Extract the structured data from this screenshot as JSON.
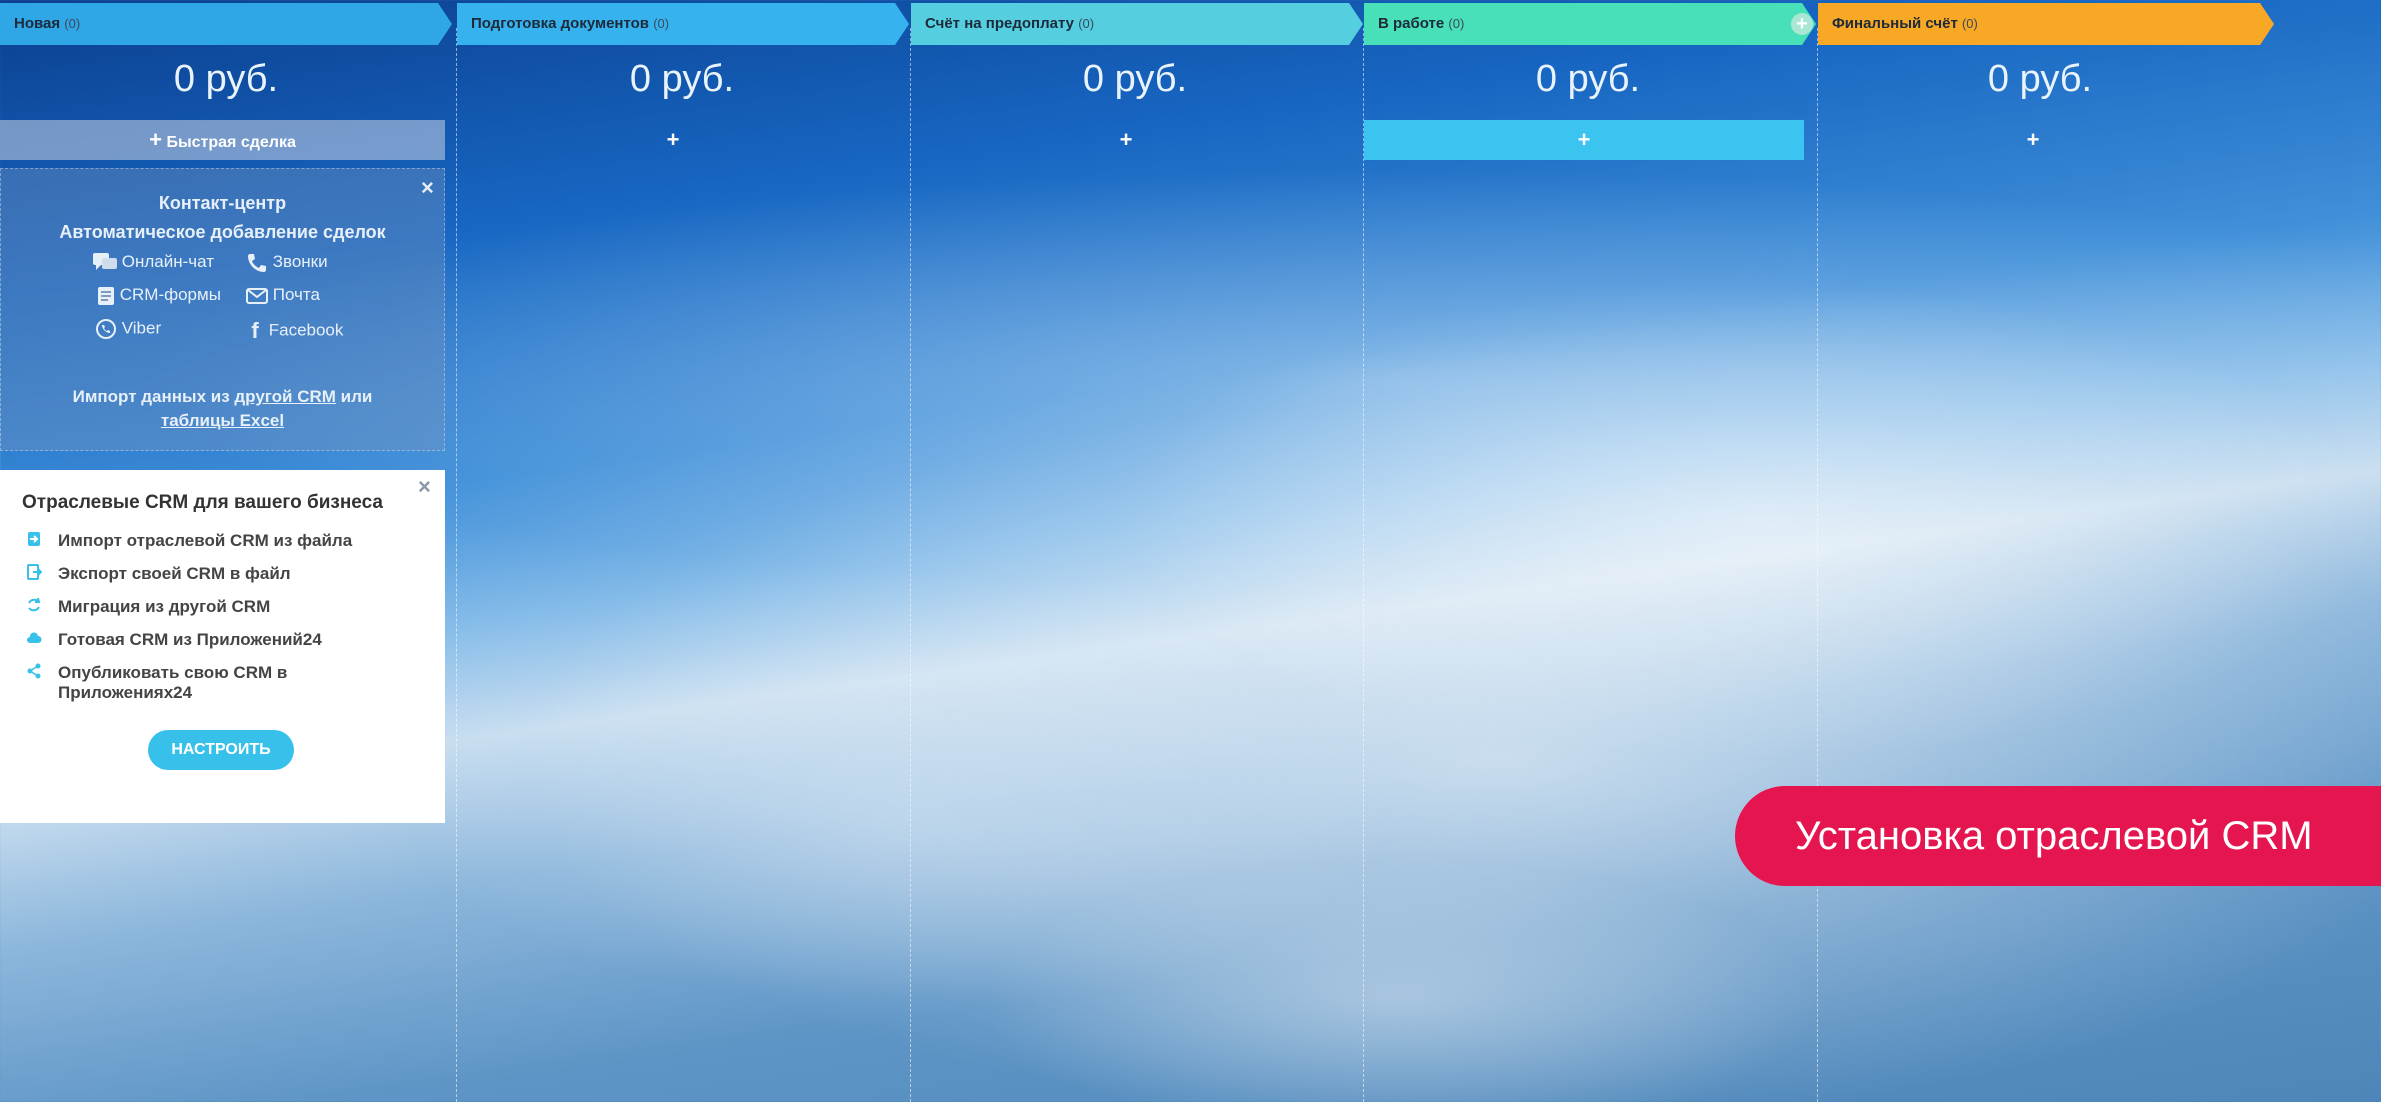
{
  "stages": [
    {
      "title": "Новая",
      "count": "(0)",
      "sum": "0 руб.",
      "color": "#2fa6e6",
      "button": "Быстрая сделка"
    },
    {
      "title": "Подготовка документов",
      "count": "(0)",
      "sum": "0 руб.",
      "color": "#36b3ee",
      "button": "+"
    },
    {
      "title": "Счёт на предоплату",
      "count": "(0)",
      "sum": "0 руб.",
      "color": "#55cfe0",
      "button": "+"
    },
    {
      "title": "В работе",
      "count": "(0)",
      "sum": "0 руб.",
      "color": "#47e0b8",
      "button": "+"
    },
    {
      "title": "Финальный счёт",
      "count": "(0)",
      "sum": "0 руб.",
      "color": "#f9a825",
      "button": "+"
    }
  ],
  "contact_center": {
    "title": "Контакт-центр",
    "subtitle": "Автоматическое добавление сделок",
    "channels": [
      "Онлайн-чат",
      "Звонки",
      "CRM-формы",
      "Почта",
      "Viber",
      "Facebook"
    ],
    "import_text_1": "Импорт данных из",
    "import_link_1": "другой CRM",
    "import_text_2": "или",
    "import_link_2": "таблицы Excel"
  },
  "industry_crm": {
    "title": "Отраслевые CRM для вашего бизнеса",
    "items": [
      "Импорт отраслевой CRM из файла",
      "Экспорт своей CRM в файл",
      "Миграция из другой CRM",
      "Готовая CRM из Приложений24",
      "Опубликовать свою CRM в",
      "Приложениях24"
    ],
    "button": "НАСТРОИТЬ"
  },
  "banner": "Установка отраслевой CRM",
  "colors": {
    "accent": "#37c1ea",
    "banner": "#e4154f"
  }
}
